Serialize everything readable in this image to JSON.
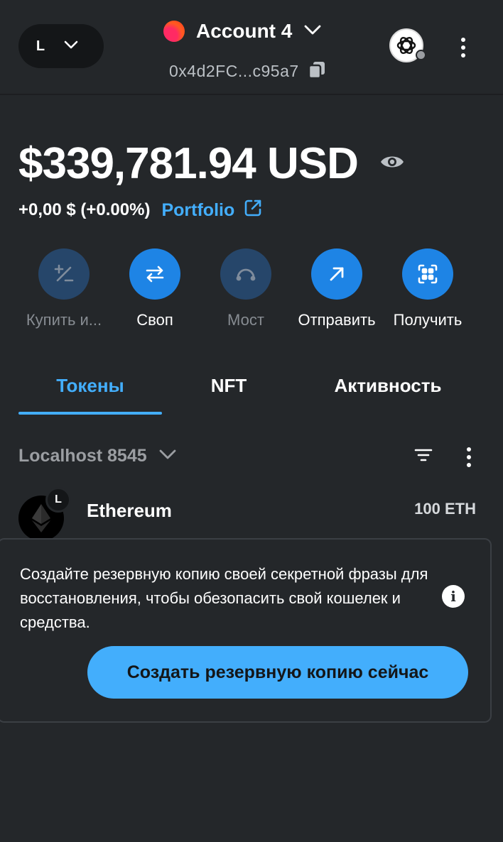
{
  "header": {
    "network_letter": "L",
    "account_name": "Account 4",
    "address": "0x4d2FC...c95a7",
    "icons": [
      "chevron-down-icon",
      "copy-icon",
      "openai-avatar-icon",
      "kebab-menu-icon"
    ]
  },
  "balance": {
    "amount": "$339,781.94 USD",
    "change": "+0,00 $ (+0.00%)",
    "portfolio_label": "Portfolio"
  },
  "actions": [
    {
      "label": "Купить и...",
      "icon": "buy-sell-icon",
      "enabled": false
    },
    {
      "label": "Своп",
      "icon": "swap-icon",
      "enabled": true
    },
    {
      "label": "Мост",
      "icon": "bridge-icon",
      "enabled": false
    },
    {
      "label": "Отправить",
      "icon": "send-arrow-icon",
      "enabled": true
    },
    {
      "label": "Получить",
      "icon": "qr-receive-icon",
      "enabled": true
    }
  ],
  "tabs": [
    {
      "label": "Токены",
      "active": true
    },
    {
      "label": "NFT",
      "active": false
    },
    {
      "label": "Активность",
      "active": false
    }
  ],
  "network_filter": {
    "name": "Localhost 8545"
  },
  "tokens": [
    {
      "name": "Ethereum",
      "amount": "100 ETH",
      "badge": "L"
    }
  ],
  "backup_banner": {
    "text": "Создайте резервную копию своей секретной фразы для восстановления, чтобы обезопасить свой кошелек и средства.",
    "button_label": "Создать резервную копию сейчас",
    "info_glyph": "i"
  },
  "colors": {
    "background": "#24272a",
    "accent": "#43aefc",
    "button_primary": "#1e84e5",
    "button_disabled": "#26466a"
  }
}
